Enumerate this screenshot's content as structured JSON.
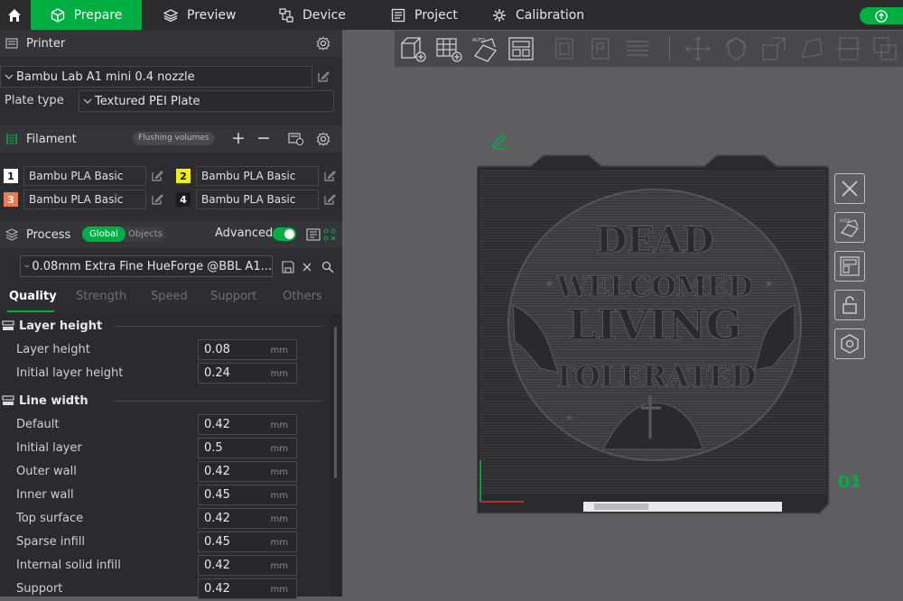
{
  "topbar": {
    "tabs": [
      {
        "label": "Prepare",
        "icon": "cube-icon"
      },
      {
        "label": "Preview",
        "icon": "layers-icon"
      },
      {
        "label": "Device",
        "icon": "device-icon"
      },
      {
        "label": "Project",
        "icon": "project-icon"
      },
      {
        "label": "Calibration",
        "icon": "calibration-icon"
      }
    ],
    "accent": "#00ae42"
  },
  "printer": {
    "title": "Printer",
    "model": "Bambu Lab A1 mini 0.4 nozzle",
    "plate_type_label": "Plate type",
    "plate_type": "Textured PEI Plate"
  },
  "filament": {
    "title": "Filament",
    "flushing_label": "Flushing volumes",
    "slots": [
      {
        "num": "1",
        "name": "Bambu PLA Basic",
        "color": "#ffffff"
      },
      {
        "num": "2",
        "name": "Bambu PLA Basic",
        "color": "#f5f000"
      },
      {
        "num": "3",
        "name": "Bambu PLA Basic",
        "color": "#f07a4a"
      },
      {
        "num": "4",
        "name": "Bambu PLA Basic",
        "color": "#1c1c1c"
      }
    ]
  },
  "process": {
    "title": "Process",
    "global_label": "Global",
    "objects_label": "Objects",
    "advanced_label": "Advanced",
    "advanced_on": true,
    "preset": "0.08mm Extra Fine HueForge @BBL A1...",
    "tabs": [
      "Quality",
      "Strength",
      "Speed",
      "Support",
      "Others"
    ],
    "active_tab": "Quality"
  },
  "params": {
    "layer_height_group": "Layer height",
    "line_width_group": "Line width",
    "unit": "mm",
    "rows": [
      {
        "label": "Layer height",
        "value": "0.08"
      },
      {
        "label": "Initial layer height",
        "value": "0.24"
      },
      {
        "label": "Default",
        "value": "0.42"
      },
      {
        "label": "Initial layer",
        "value": "0.5"
      },
      {
        "label": "Outer wall",
        "value": "0.42"
      },
      {
        "label": "Inner wall",
        "value": "0.45"
      },
      {
        "label": "Top surface",
        "value": "0.42"
      },
      {
        "label": "Sparse infill",
        "value": "0.45"
      },
      {
        "label": "Internal solid infill",
        "value": "0.42"
      },
      {
        "label": "Support",
        "value": "0.42"
      }
    ]
  },
  "canvas": {
    "plate_number": "01",
    "model_text": [
      "DEAD",
      "WELCOMED",
      "LIVING",
      "TOLERATED"
    ]
  }
}
